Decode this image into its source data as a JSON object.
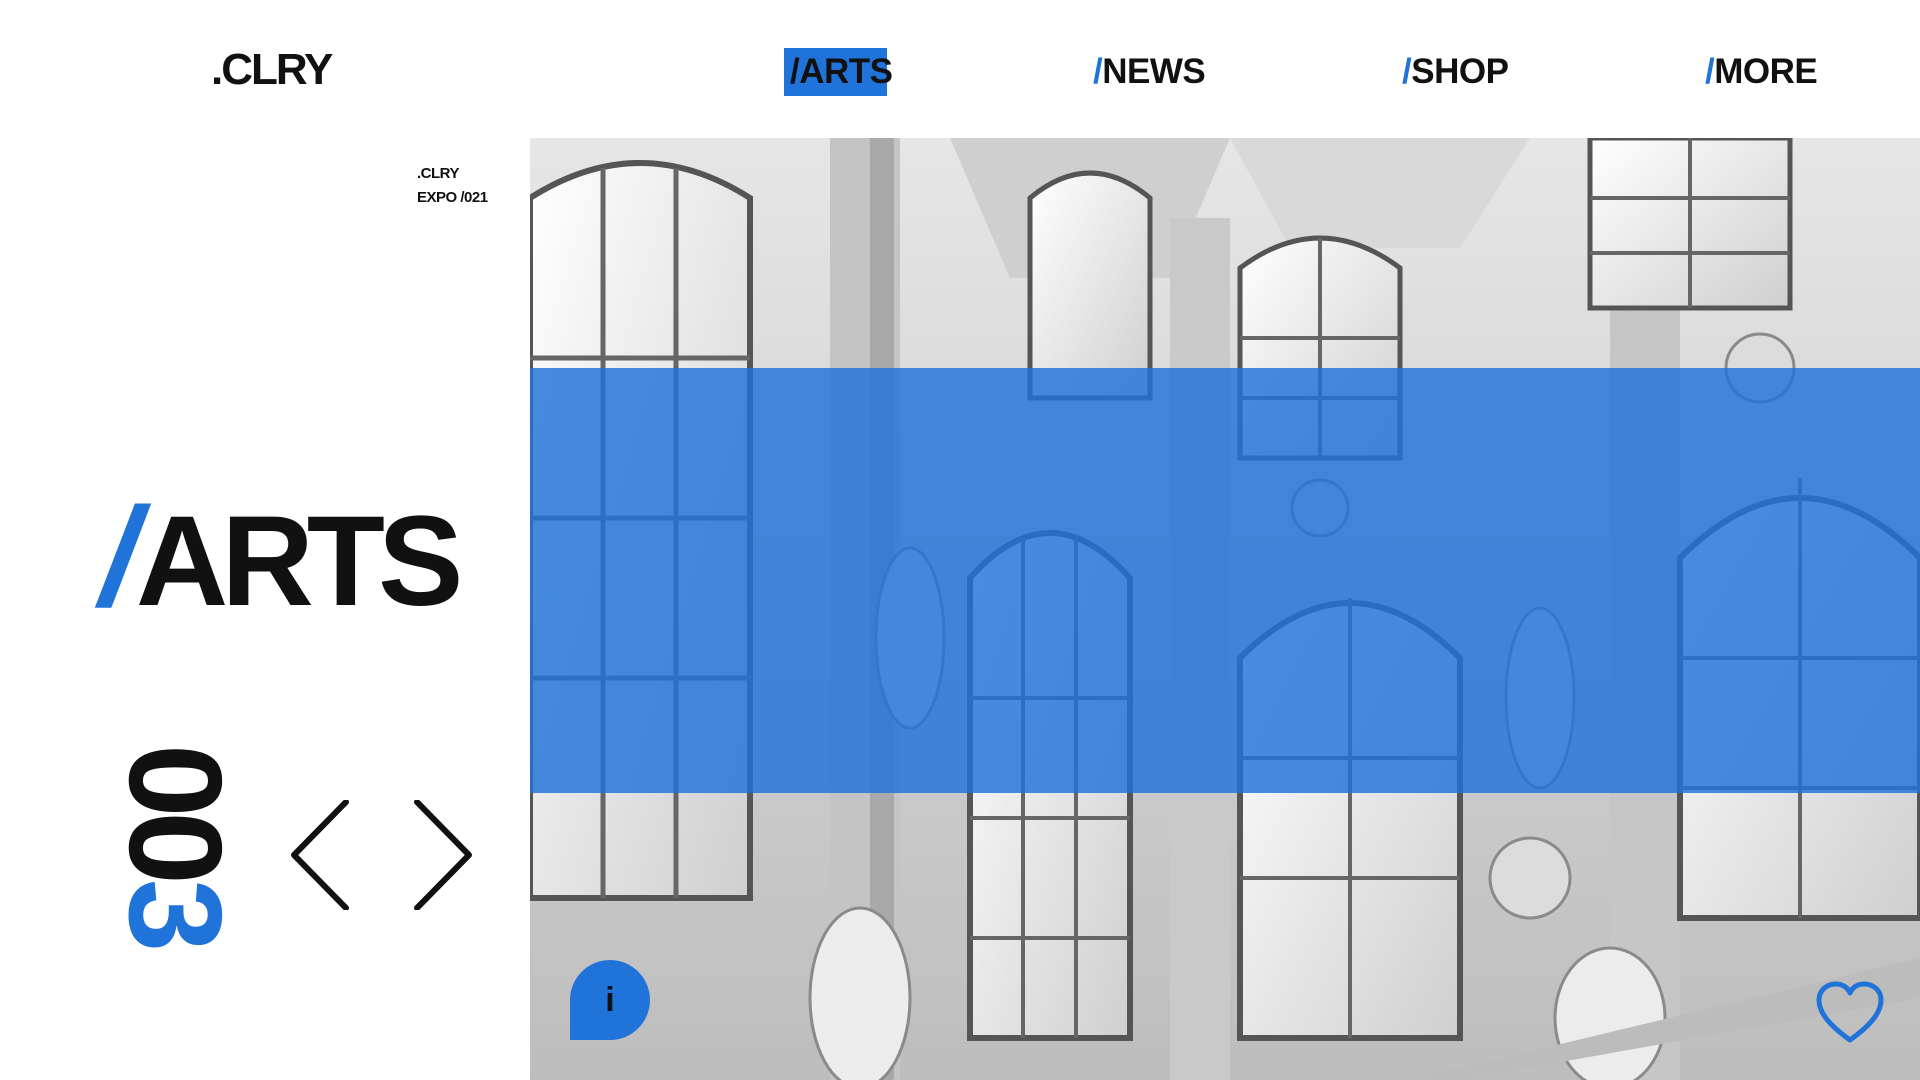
{
  "brand": {
    "logo": ".CLRY"
  },
  "nav": {
    "items": [
      {
        "slash": "/",
        "label": "ARTS"
      },
      {
        "slash": "/",
        "label": "NEWS"
      },
      {
        "slash": "/",
        "label": "SHOP"
      },
      {
        "slash": "/",
        "label": "MORE"
      }
    ],
    "active": "ARTS"
  },
  "expo": {
    "line1": ".CLRY",
    "line2": "EXPO /021"
  },
  "section": {
    "slash": "/",
    "title": "ARTS"
  },
  "counter": {
    "prefix": "00",
    "last": "3"
  },
  "controls": {
    "prev_icon": "chevron-left-icon",
    "next_icon": "chevron-right-icon",
    "info_label": "i",
    "info_icon": "info-icon",
    "favorite_icon": "heart-icon"
  },
  "colors": {
    "accent": "#1f73d9",
    "text": "#111111",
    "background": "#ffffff"
  }
}
